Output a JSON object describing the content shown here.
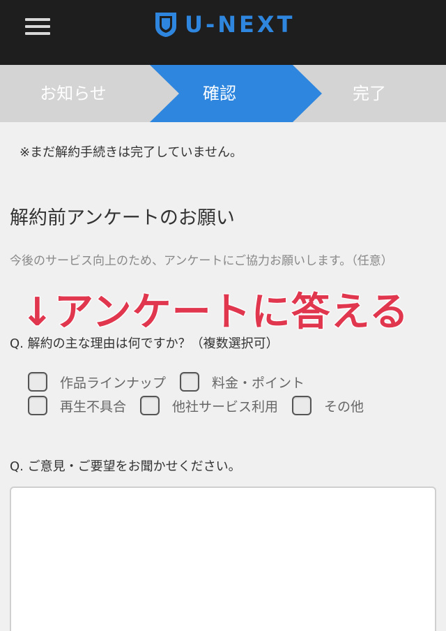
{
  "header": {
    "logo_text": "U-NEXT",
    "menu_icon": "hamburger-menu-icon",
    "logo_icon": "u-next-shield-icon",
    "brand_color": "#2e86de"
  },
  "steps": {
    "items": [
      {
        "label": "お知らせ",
        "active": false
      },
      {
        "label": "確認",
        "active": true
      },
      {
        "label": "完了",
        "active": false
      }
    ],
    "active_color": "#2e86de",
    "inactive_color": "#d4d4d4"
  },
  "notice": "※まだ解約手続きは完了していません。",
  "survey": {
    "title": "解約前アンケートのお願い",
    "description": "今後のサービス向上のため、アンケートにご協力お願いします。（任意）",
    "overlay": "↓アンケートに答える",
    "q1": "Q. 解約の主な理由は何ですか？（複数選択可）",
    "options_row1": [
      "作品ラインナップ",
      "料金・ポイント"
    ],
    "options_row2": [
      "再生不具合",
      "他社サービス利用",
      "その他"
    ],
    "q2": "Q. ご意見・ご要望をお聞かせください。",
    "comment_value": ""
  }
}
